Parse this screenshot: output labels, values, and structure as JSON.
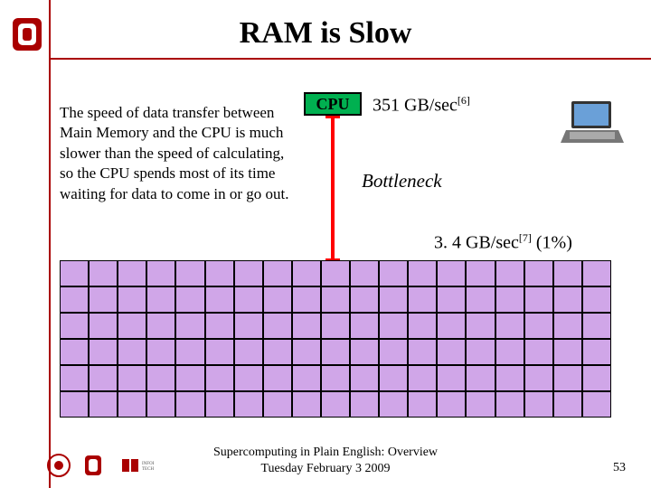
{
  "title": "RAM is Slow",
  "body_text": "The speed of data transfer between Main Memory and the CPU is much slower than the speed of calculating, so the CPU spends most of its time waiting for data to come in or go out.",
  "cpu": {
    "label": "CPU",
    "speed_value": "351 GB/sec",
    "speed_ref": "[6]"
  },
  "bottleneck_label": "Bottleneck",
  "ram": {
    "speed_value": "3. 4 GB/sec",
    "speed_ref": "[7]",
    "speed_pct": "(1%)"
  },
  "memory_grid": {
    "cols": 19,
    "rows": 6
  },
  "footer": {
    "line1": "Supercomputing in Plain English: Overview",
    "line2": "Tuesday February 3 2009"
  },
  "slide_number": "53",
  "colors": {
    "rule": "#a00",
    "cpu_fill": "#00b050",
    "bottleneck": "#ff0000",
    "grid_fill": "#d0a6e8"
  }
}
